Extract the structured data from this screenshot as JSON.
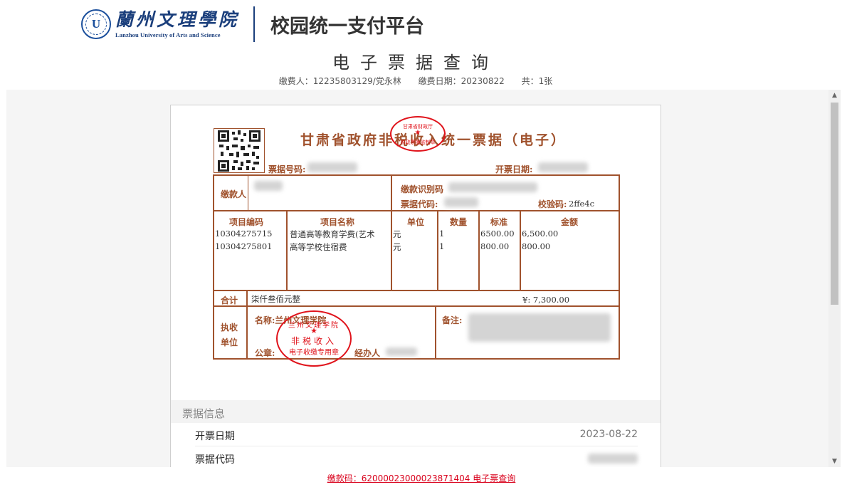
{
  "header": {
    "logo_cn": "蘭州文理學院",
    "logo_en": "Lanzhou University of Arts and Science",
    "platform_title": "校园统一支付平台"
  },
  "page": {
    "title": "电子票据查询",
    "payer_label": "缴费人：12235803129/党永林",
    "date_label": "缴费日期：20230822",
    "count_label": "共：1张"
  },
  "receipt": {
    "title": "甘肃省政府非税收入统一票据（电子）",
    "receipt_no_label": "票据号码:",
    "issue_date_label": "开票日期:",
    "payer_label": "缴款人",
    "payer_id_label": "缴款识别码",
    "receipt_code_label": "票据代码:",
    "receipt_code_partial": "...00120",
    "check_code_label": "校验码:",
    "check_code": "2ffe4c",
    "columns": [
      "项目编码",
      "项目名称",
      "单位",
      "数量",
      "标准",
      "金额"
    ],
    "items": [
      {
        "code": "10304275715",
        "name": "普通高等教育学费(艺术",
        "unit": "元",
        "qty": "1",
        "std": "6500.00",
        "amount": "6,500.00"
      },
      {
        "code": "10304275801",
        "name": "高等学校住宿费",
        "unit": "元",
        "qty": "1",
        "std": "800.00",
        "amount": "800.00"
      }
    ],
    "total_label": "合计",
    "total_words": "柒仟叁佰元整",
    "total_amount": "¥: 7,300.00",
    "collector_label_1": "执收",
    "collector_label_2": "单位",
    "name_label": "名称:兰州文理学院",
    "seal_label": "公章:",
    "handler_label": "经办人",
    "remark_label": "备注:",
    "stamp_big": {
      "line1": "兰州文理学院",
      "line2": "非税收入",
      "line3": "电子收缴专用章"
    },
    "stamp_small": {
      "line1": "甘肃省财政厅",
      "line2": "财政票据监制章"
    }
  },
  "info": {
    "section_title": "票据信息",
    "rows": [
      {
        "label": "开票日期",
        "value": "2023-08-22"
      },
      {
        "label": "票据代码",
        "value": ""
      }
    ]
  },
  "footer": {
    "link_text": "缴款码：62000023000023871404 电子票查询"
  },
  "colors": {
    "receipt_brown": "#a0522d",
    "stamp_red": "#e0131b",
    "brand_blue": "#1b3f7c",
    "link_red": "#d9001b"
  }
}
